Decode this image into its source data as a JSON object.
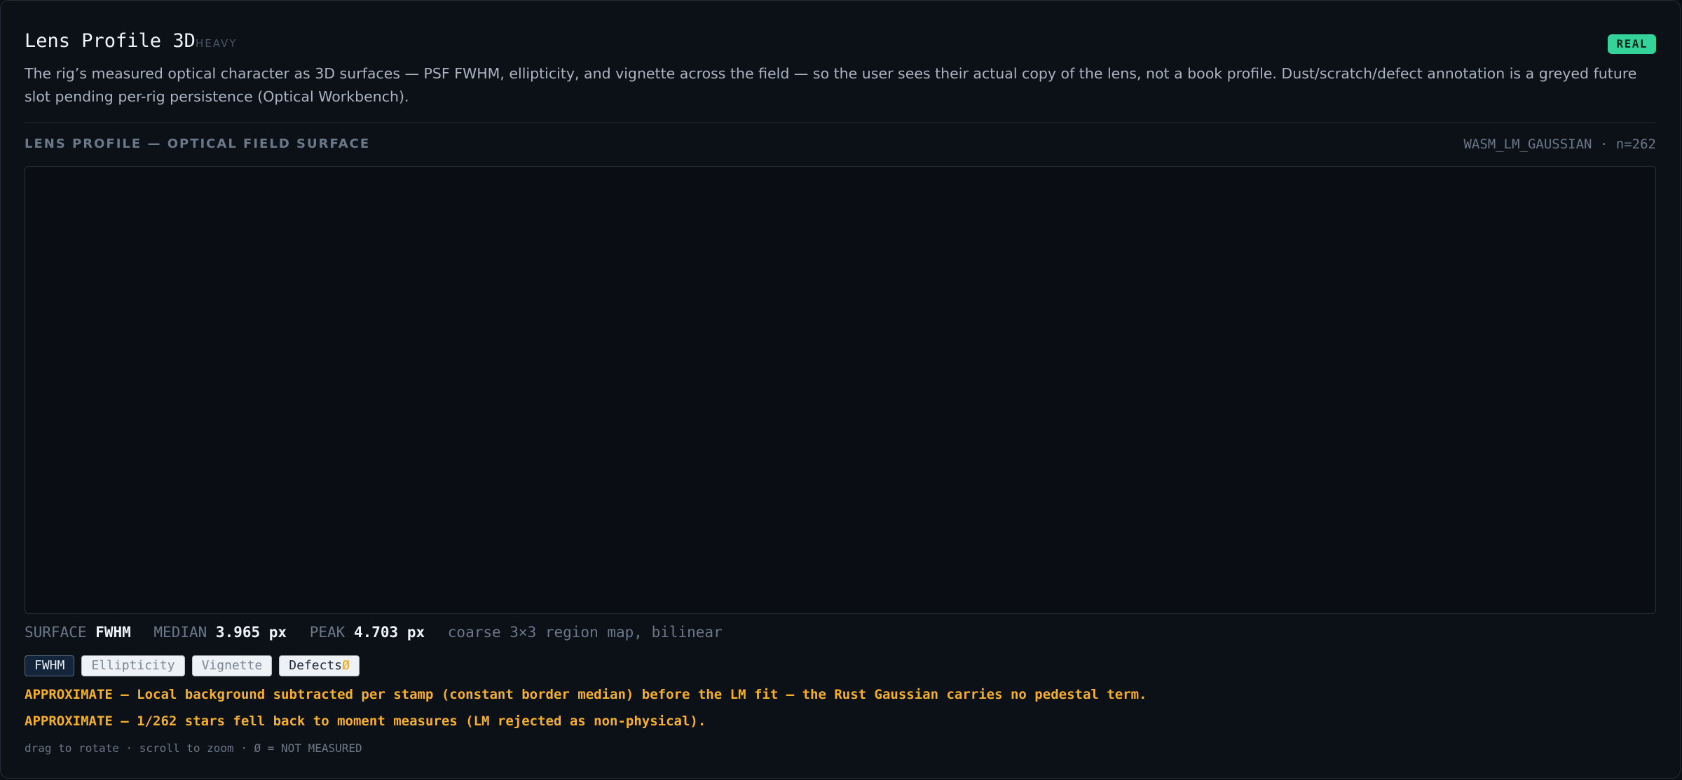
{
  "header": {
    "title": "Lens Profile 3D",
    "weight": "HEAVY",
    "badge": "REAL",
    "description": "The rig’s measured optical character as 3D surfaces — PSF FWHM, ellipticity, and vignette across the field — so the user sees their actual copy of the lens, not a book profile. Dust/scratch/defect annotation is a greyed future slot pending per-rig persistence (Optical Workbench)."
  },
  "section": {
    "title": "LENS PROFILE — OPTICAL FIELD SURFACE",
    "source": "WASM_LM_GAUSSIAN · n=262"
  },
  "stats": {
    "surface_label": "SURFACE",
    "surface_value": "FWHM",
    "median_label": "MEDIAN",
    "median_value": "3.965 px",
    "peak_label": "PEAK",
    "peak_value": "4.703 px",
    "note": "coarse 3×3 region map, bilinear"
  },
  "tabs": [
    {
      "label": "FWHM",
      "state": "active"
    },
    {
      "label": "Ellipticity",
      "state": "idle"
    },
    {
      "label": "Vignette",
      "state": "idle"
    },
    {
      "label": "Defects",
      "suffix": "Ø",
      "state": "idle"
    }
  ],
  "warnings": [
    "APPROXIMATE — Local background subtracted per stamp (constant border median) before the LM fit — the Rust Gaussian carries no pedestal term.",
    "APPROXIMATE — 1/262 stars fell back to moment measures (LM rejected as non-physical)."
  ],
  "hint": "drag to rotate · scroll to zoom · Ø = NOT MEASURED",
  "colors": {
    "badge": "#34d399",
    "warning": "#f5b027",
    "null_mark": "#f59e0b"
  }
}
